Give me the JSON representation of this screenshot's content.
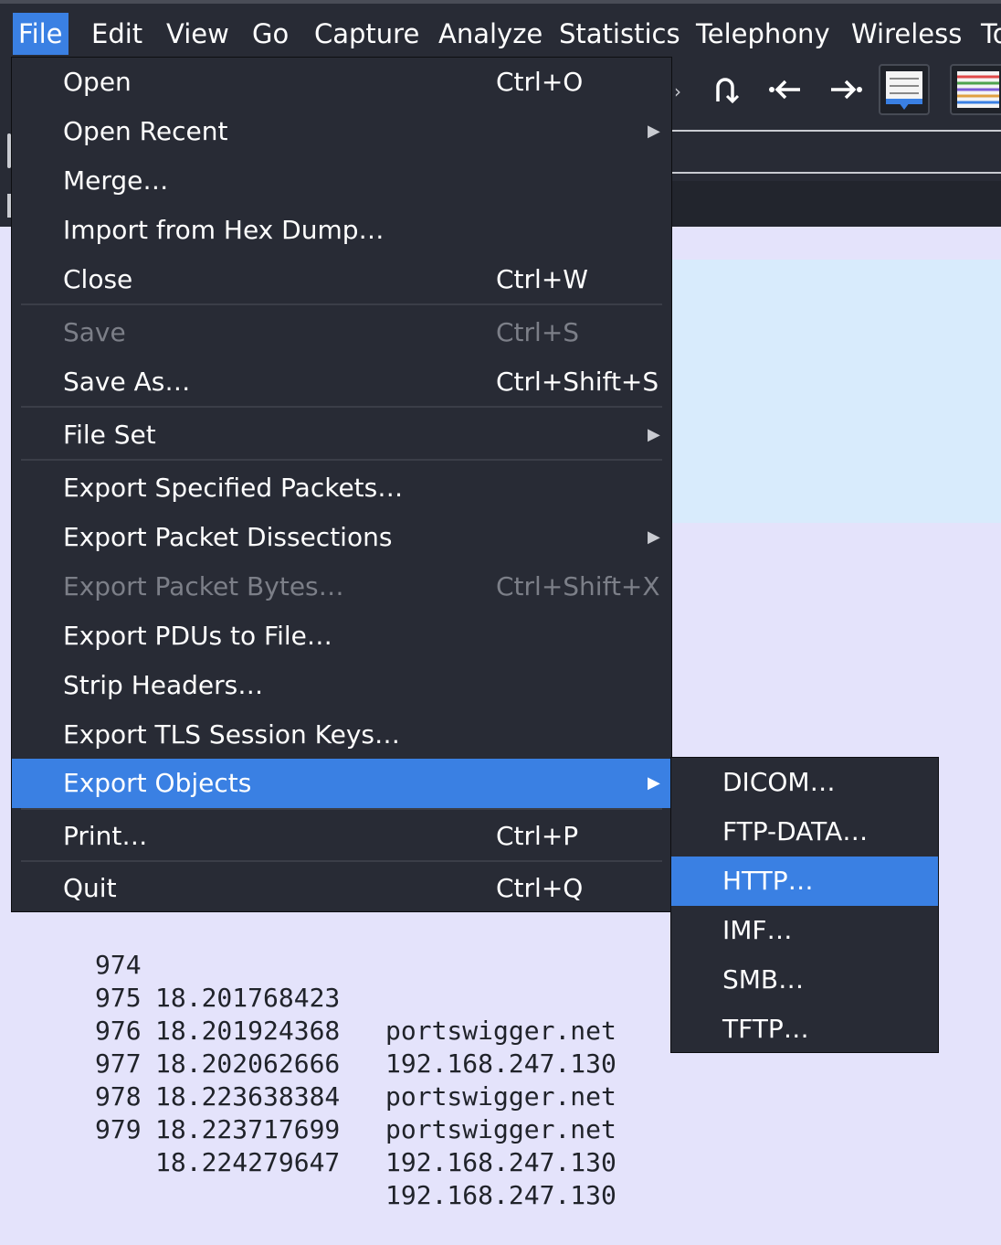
{
  "menubar": {
    "items": [
      "File",
      "Edit",
      "View",
      "Go",
      "Capture",
      "Analyze",
      "Statistics",
      "Telephony",
      "Wireless",
      "To"
    ]
  },
  "file_menu": {
    "items": [
      {
        "label": "Open",
        "shortcut": "Ctrl+O"
      },
      {
        "label": "Open Recent",
        "shortcut": ""
      },
      {
        "label": "Merge…",
        "shortcut": ""
      },
      {
        "label": "Import from Hex Dump…",
        "shortcut": ""
      },
      {
        "label": "Close",
        "shortcut": "Ctrl+W"
      },
      {
        "label": "Save",
        "shortcut": "Ctrl+S"
      },
      {
        "label": "Save As…",
        "shortcut": "Ctrl+Shift+S"
      },
      {
        "label": "File Set",
        "shortcut": ""
      },
      {
        "label": "Export Specified Packets…",
        "shortcut": ""
      },
      {
        "label": "Export Packet Dissections",
        "shortcut": ""
      },
      {
        "label": "Export Packet Bytes…",
        "shortcut": "Ctrl+Shift+X"
      },
      {
        "label": "Export PDUs to File…",
        "shortcut": ""
      },
      {
        "label": "Strip Headers…",
        "shortcut": ""
      },
      {
        "label": "Export TLS Session Keys…",
        "shortcut": ""
      },
      {
        "label": "Export Objects",
        "shortcut": ""
      },
      {
        "label": "Print…",
        "shortcut": "Ctrl+P"
      },
      {
        "label": "Quit",
        "shortcut": "Ctrl+Q"
      }
    ]
  },
  "export_objects_submenu": {
    "items": [
      "DICOM…",
      "FTP-DATA…",
      "HTTP…",
      "IMF…",
      "SMB…",
      "TFTP…"
    ]
  },
  "packets": [
    {
      "no": "974",
      "time": "18.201768423",
      "source": "portswigger.net"
    },
    {
      "no": "975",
      "time": "18.201924368",
      "source": "192.168.247.130"
    },
    {
      "no": "976",
      "time": "18.202062666",
      "source": "portswigger.net"
    },
    {
      "no": "977",
      "time": "18.223638384",
      "source": "portswigger.net"
    },
    {
      "no": "978",
      "time": "18.223717699",
      "source": "192.168.247.130"
    },
    {
      "no": "979",
      "time": "18.224279647",
      "source": "192.168.247.130"
    }
  ],
  "toolbar": {
    "icons": [
      "restart-capture-icon",
      "go-previous-icon",
      "go-next-icon",
      "autoscroll-icon",
      "colorize-icon"
    ]
  },
  "colors": {
    "menu_bg": "#282b35",
    "highlight": "#3a80e3",
    "disabled_text": "#7c7f88",
    "packet_list_bg": "#e4e3fb",
    "selected_row_bg": "#d8ebfc"
  }
}
